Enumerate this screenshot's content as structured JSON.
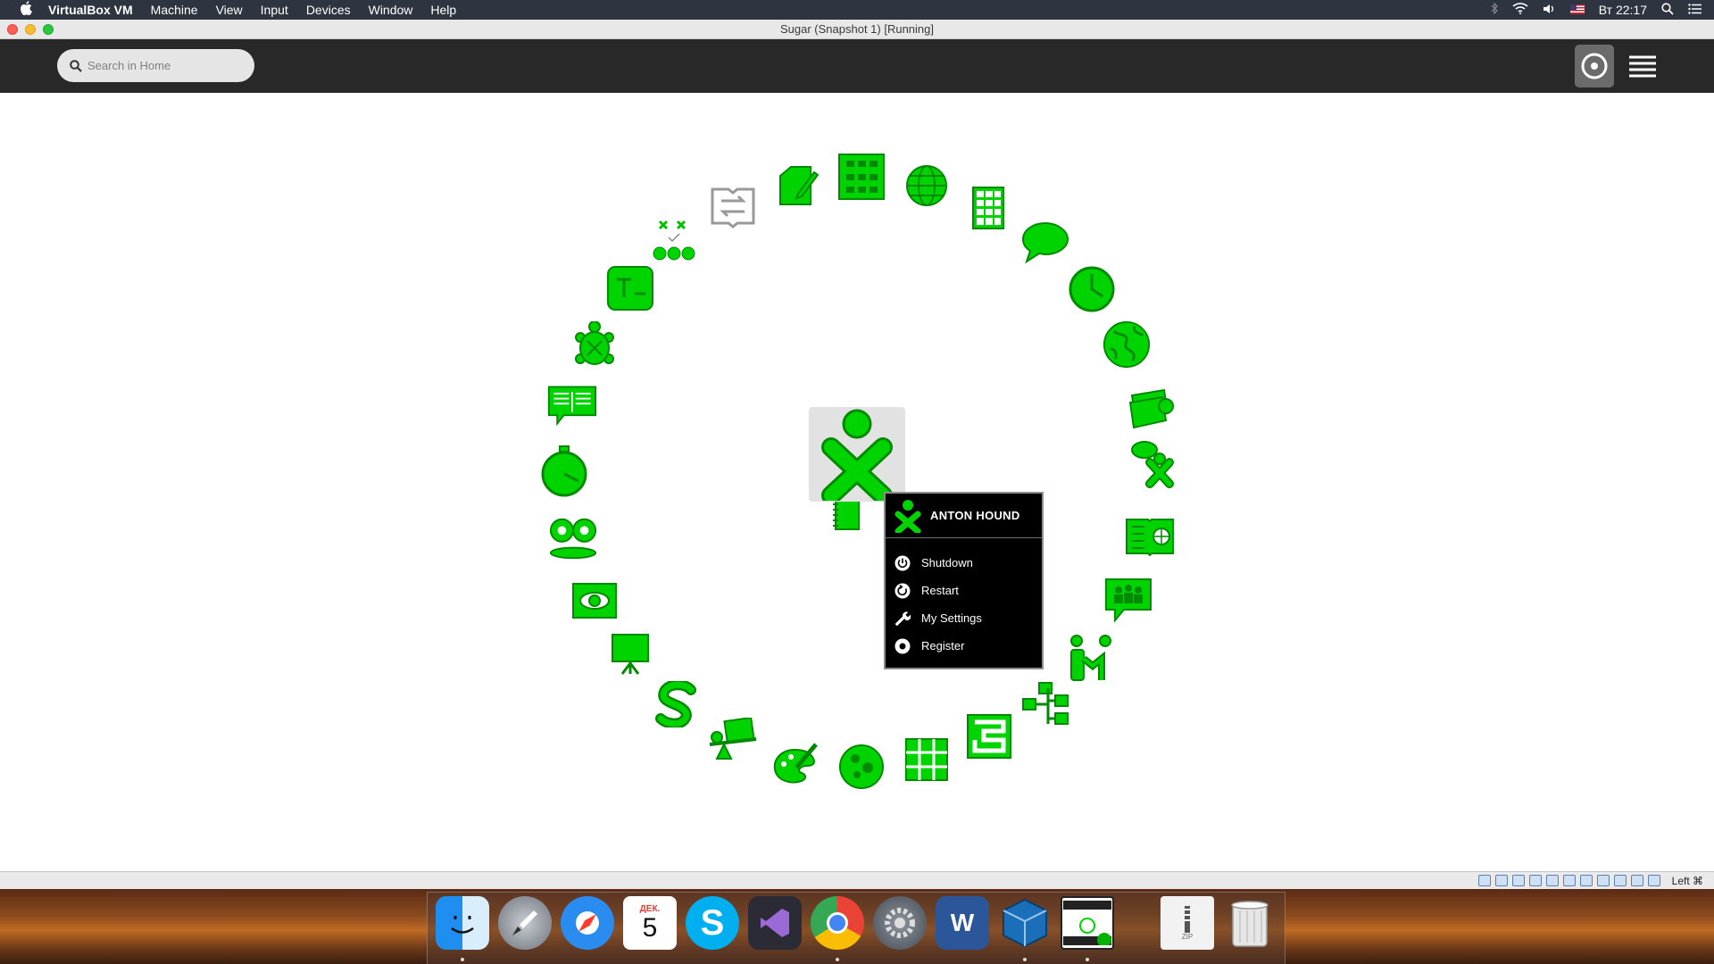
{
  "menubar": {
    "apple": "",
    "items": [
      "VirtualBox VM",
      "Machine",
      "View",
      "Input",
      "Devices",
      "Window",
      "Help"
    ],
    "clock": "Вт 22:17"
  },
  "window": {
    "title": "Sugar (Snapshot 1) [Running]"
  },
  "sugar": {
    "search_placeholder": "Search in Home",
    "accent": "#00d400",
    "stroke": "#008a00"
  },
  "palette": {
    "user": "ANTON HOUND",
    "items": [
      "Shutdown",
      "Restart",
      "My Settings",
      "Register"
    ]
  },
  "statusbar": {
    "host_key": "Left ⌘"
  },
  "dock": {
    "calendar_month": "ДЕК.",
    "calendar_day": "5",
    "word_letter": "W",
    "zip_label": "ZIP"
  }
}
